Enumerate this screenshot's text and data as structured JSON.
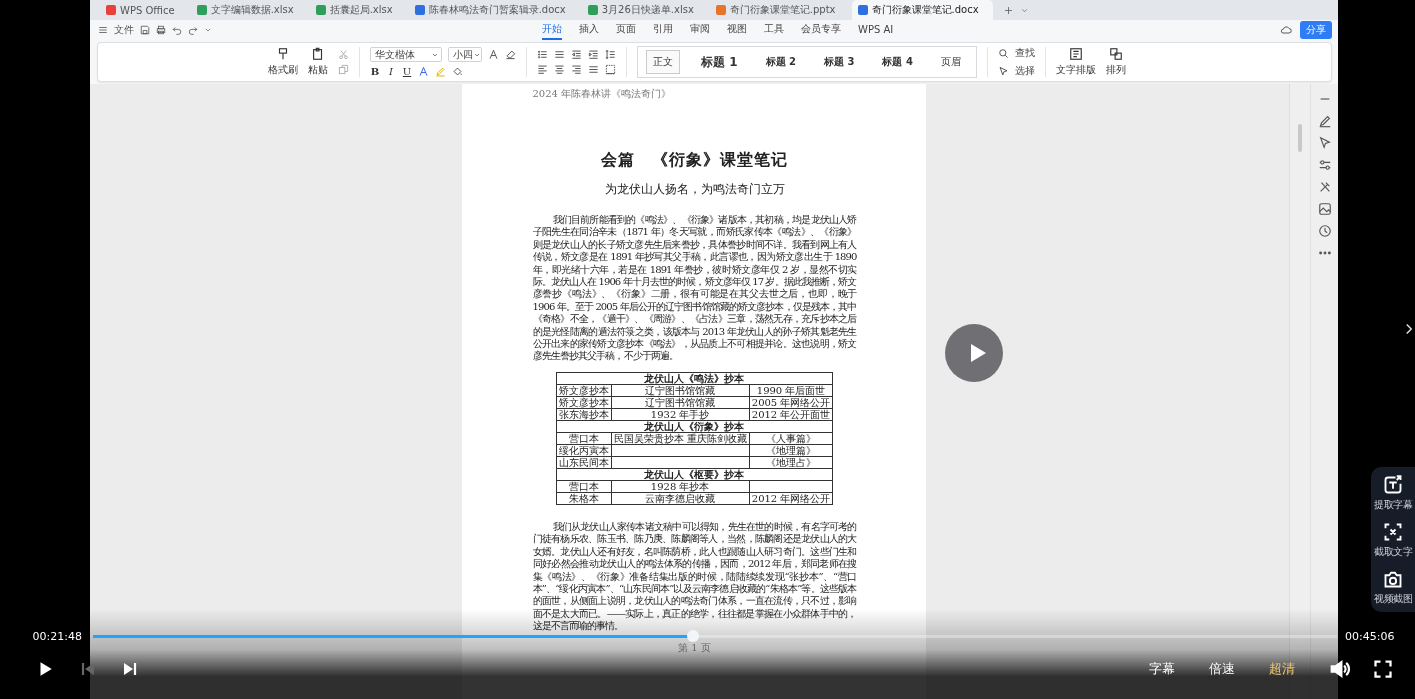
{
  "wps": {
    "tabs": [
      {
        "label": "WPS Office",
        "kind": "home",
        "selected": false
      },
      {
        "label": "文字编辑数据.xlsx",
        "kind": "sheet",
        "selected": false
      },
      {
        "label": "括囊起局.xlsx",
        "kind": "sheet",
        "selected": false
      },
      {
        "label": "陈春林鸣法奇门暂案辑录.docx",
        "kind": "doc",
        "selected": false
      },
      {
        "label": "3月26日快递单.xlsx",
        "kind": "sheet",
        "selected": false
      },
      {
        "label": "奇门衍象课堂笔记.pptx",
        "kind": "slides",
        "selected": false
      },
      {
        "label": "奇门衍象课堂笔记.docx",
        "kind": "doc",
        "selected": true
      }
    ],
    "menu": {
      "file": "文件",
      "share": "分享",
      "tabs": [
        {
          "label": "开始",
          "selected": true
        },
        {
          "label": "插入",
          "selected": false
        },
        {
          "label": "页面",
          "selected": false
        },
        {
          "label": "引用",
          "selected": false
        },
        {
          "label": "审阅",
          "selected": false
        },
        {
          "label": "视图",
          "selected": false
        },
        {
          "label": "工具",
          "selected": false
        },
        {
          "label": "会员专享",
          "selected": false
        },
        {
          "label": "WPS AI",
          "selected": false
        }
      ]
    },
    "ribbon": {
      "clipboard": [
        "格式刷",
        "粘贴"
      ],
      "font": {
        "family": "华文楷体",
        "size": "小四"
      },
      "format": [
        "B",
        "I",
        "U"
      ],
      "styles": [
        {
          "label": "正文",
          "selected": true
        },
        {
          "label": "标题 1",
          "selected": false
        },
        {
          "label": "标题 2",
          "selected": false
        },
        {
          "label": "标题 3",
          "selected": false
        },
        {
          "label": "标题 4",
          "selected": false
        },
        {
          "label": "页眉",
          "selected": false
        }
      ],
      "find": [
        "查找",
        "选择"
      ],
      "layout": [
        "文字排版",
        "排列"
      ]
    },
    "document": {
      "header": "2024 年陈春林讲《鸣法奇门》",
      "title": "会篇　《衍象》课堂笔记",
      "subtitle": "为龙伏山人扬名，为鸣法奇门立万",
      "body": [
        {
          "kind": "paragraph",
          "text": "我们目前所能看到的《鸣法》、《衍象》诸版本，其初稿，均是龙伏山人矫子阳先生在同治辛未（1871 年）冬天写就，而矫氏家传本《鸣法》、《衍象》则是龙伏山人的长子矫文彦先生后来誊抄，具体誊抄时间不详。我看到网上有人传说，矫文彦是在 1891 年抄写其父手稿，此言谬也，因为矫文彦出生于 1890 年，即光绪十六年，若是在 1891 年誊抄，彼时矫文彦年仅 2 岁，显然不切实际。龙伏山人在 1906 年十月去世的时候，矫文彦年仅 17 岁。据此我推断，矫文彦誊抄《鸣法》、《衍象》二册，很有可能是在其父去世之后，也即，晚于 1906 年。至于 2005 年后公开的辽宁图书馆馆藏的矫文彦抄本，仅是残本，其中《奇格》不全，《遁干》、《周游》、《占法》三章，荡然无存，充斥抄本之后的是光怪陆离的遁法符箓之类，该版本与 2013 年龙伏山人的孙子矫其魁老先生公开出来的家传矫文彦抄本《鸣法》，从品质上不可相提并论。这也说明，矫文彦先生誊抄其父手稿，不少于两遍。"
        },
        {
          "kind": "table",
          "sections": [
            {
              "title": "龙伏山人《鸣法》抄本",
              "rows": [
                [
                  "矫文彦抄本",
                  "辽宁图书馆馆藏",
                  "1990 年后面世"
                ],
                [
                  "矫文彦抄本",
                  "辽宁图书馆馆藏",
                  "2005 年网络公开"
                ],
                [
                  "张东海抄本",
                  "1932 年手抄",
                  "2012 年公开面世"
                ]
              ]
            },
            {
              "title": "龙伏山人《衍象》抄本",
              "rows": [
                [
                  "营口本",
                  "民国吴荣贵抄本 重庆陈剑收藏",
                  "《人事篇》"
                ],
                [
                  "绥化丙寅本",
                  null,
                  "《地理篇》"
                ],
                [
                  "山东民间本",
                  null,
                  "《地理占》"
                ]
              ]
            },
            {
              "title": "龙伏山人《枢要》抄本",
              "rows": [
                [
                  "营口本",
                  "1928 年抄本",
                  null
                ],
                [
                  "朱格本",
                  "云南李德启收藏",
                  "2012 年网络公开"
                ]
              ]
            }
          ]
        },
        {
          "kind": "paragraph",
          "text": "我们从龙伏山人家传本诸文稿中可以得知，先生在世的时候，有名字可考的门徒有杨乐农、陈玉书、陈乃庚、陈麟阁等人，当然，陈麟阁还是龙伏山人的大女婿。龙伏山人还有好友，名叫陈荫桥，此人也跟随山人研习奇门。这些门生和同好必然会推动龙伏山人的鸣法体系的传播，因而，2012 年后，郑同老师在搜集《鸣法》、《衍象》准备结集出版的时候，陆陆续续发现“张抄本”、“营口本”、“绥化丙寅本”、“山东民间本”以及云南李德启收藏的“朱格本”等。这些版本的面世，从侧面上说明，龙伏山人的鸣法奇门体系，一直在流传，只不过，影响面不是太大而已。——实际上，真正的绝学，往往都是掌握在小众群体手中的，这是不言而喻的事情。"
        }
      ],
      "footer": "第 1 页"
    }
  },
  "player": {
    "playing": false,
    "current_time": "00:21:48",
    "total_time": "00:45:06",
    "progress": {
      "level": 0.482
    },
    "prev_disabled": true,
    "options": [
      "字幕",
      "倍速",
      "超清"
    ],
    "side_panel": [
      {
        "label": "提取字幕",
        "kind": "subtitle"
      },
      {
        "label": "截取文字",
        "kind": "ocr"
      },
      {
        "label": "视频截图",
        "kind": "screenshot"
      }
    ]
  }
}
